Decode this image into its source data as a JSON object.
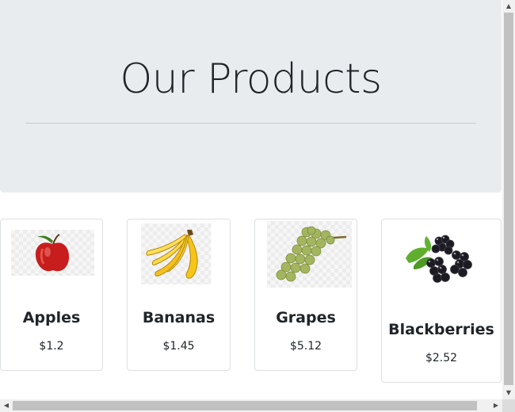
{
  "page": {
    "title": "Our Products"
  },
  "products": [
    {
      "name": "Apples",
      "price": "$1.2",
      "image_icon": "apple-image"
    },
    {
      "name": "Bananas",
      "price": "$1.45",
      "image_icon": "bananas-image"
    },
    {
      "name": "Grapes",
      "price": "$5.12",
      "image_icon": "grapes-image"
    },
    {
      "name": "Blackberries",
      "price": "$2.52",
      "image_icon": "blackberries-image"
    }
  ],
  "scrollbars": {
    "up_arrow": "▲",
    "down_arrow": "▼",
    "left_arrow": "◀",
    "right_arrow": "▶"
  },
  "colors": {
    "hero_background": "#e9ecef",
    "card_border": "#dcdfe2",
    "text": "#212529"
  }
}
